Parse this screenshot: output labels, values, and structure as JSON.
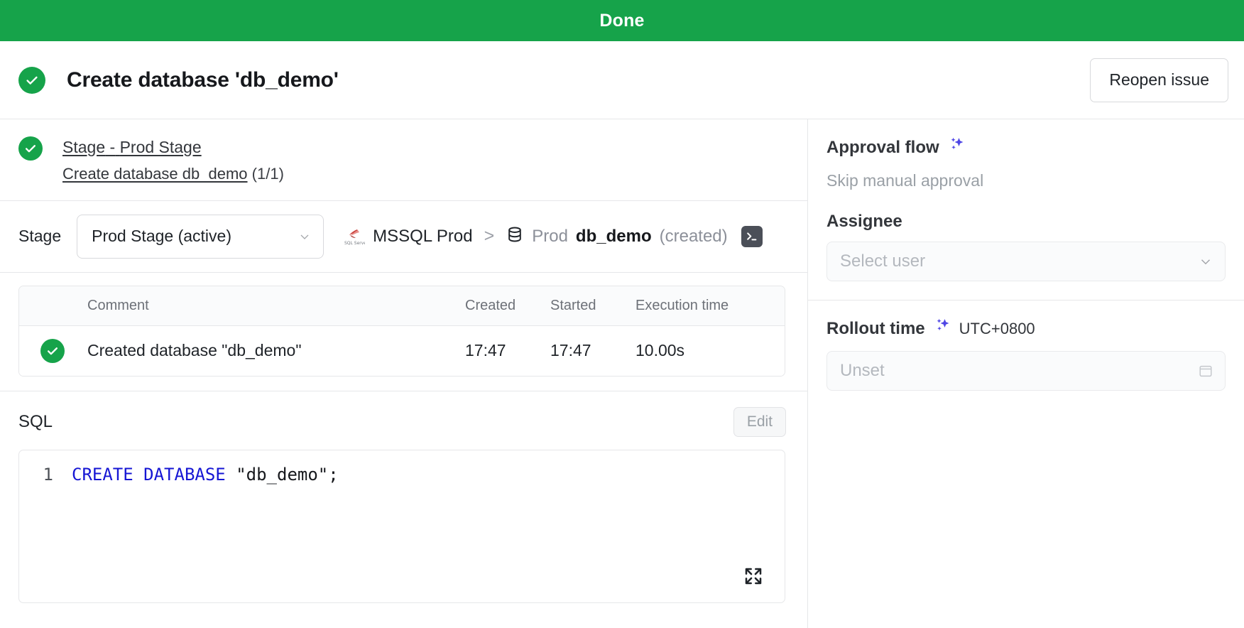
{
  "banner": {
    "status": "Done"
  },
  "header": {
    "title": "Create database 'db_demo'",
    "reopen_label": "Reopen issue",
    "status_icon": "check-circle-icon"
  },
  "stage_summary": {
    "stage_word": "Stage",
    "dash": "-",
    "stage_name": "Prod Stage",
    "task_name": "Create database db_demo",
    "task_count": "(1/1)"
  },
  "stage_row": {
    "label": "Stage",
    "selected": "Prod Stage (active)",
    "breadcrumb": {
      "instance_icon": "mssql-icon",
      "instance": "MSSQL Prod",
      "separator": ">",
      "database_icon": "database-icon",
      "db_env": "Prod",
      "db_name": "db_demo",
      "db_state": "(created)",
      "terminal_icon": "terminal-icon"
    }
  },
  "exec_table": {
    "columns": [
      "",
      "Comment",
      "Created",
      "Started",
      "Execution time"
    ],
    "rows": [
      {
        "status_icon": "check-circle-icon",
        "comment": "Created database \"db_demo\"",
        "created": "17:47",
        "started": "17:47",
        "execution_time": "10.00s"
      }
    ]
  },
  "sql": {
    "title": "SQL",
    "edit_label": "Edit",
    "line_number": "1",
    "keyword": "CREATE DATABASE",
    "literal": " \"db_demo\";",
    "expand_icon": "expand-icon"
  },
  "sidebar": {
    "approval": {
      "title": "Approval flow",
      "sparkle_icon": "sparkle-icon",
      "value": "Skip manual approval"
    },
    "assignee": {
      "label": "Assignee",
      "placeholder": "Select user",
      "chevron_icon": "chevron-down-icon"
    },
    "rollout": {
      "label": "Rollout time",
      "sparkle_icon": "sparkle-icon",
      "timezone": "UTC+0800",
      "placeholder": "Unset",
      "calendar_icon": "calendar-icon"
    }
  },
  "colors": {
    "success": "#16a34a",
    "accent": "#4f46e5",
    "keyword": "#1616d4",
    "muted": "#8c9099"
  }
}
